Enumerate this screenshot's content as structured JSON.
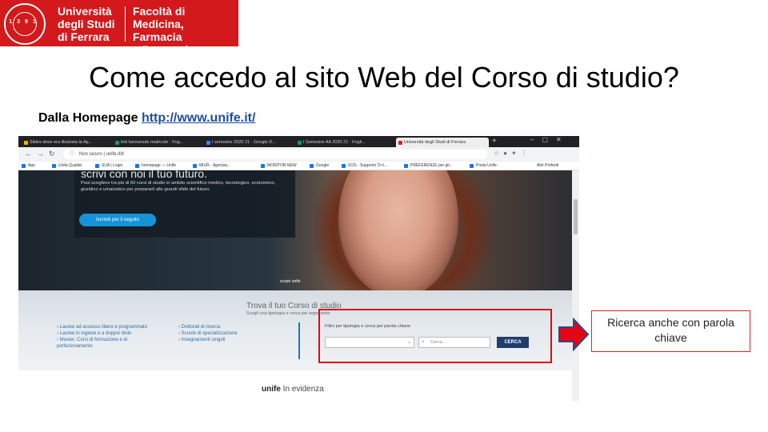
{
  "header": {
    "seal_text": "1391",
    "university": "Università\ndegli Studi\ndi Ferrara",
    "faculty": "Facoltà di Medicina,\nFarmacia\ne Prevenzione"
  },
  "slide": {
    "title": "Come accedo al sito Web del Corso di studio?",
    "subtitle_prefix": "Dalla Homepage ",
    "subtitle_link": "http://www.unife.it/",
    "callout": "Ricerca anche con parola chiave"
  },
  "browser": {
    "tabs": [
      "Slides dove era illustrata la Ap...",
      "link benvenuto matricole · Fog...",
      "I semestre 2020 21 · Google D...",
      "I Semestre AA 2020 21 · Fogli...",
      "Università degli Studi di Ferrara"
    ],
    "url": "unife.it/it",
    "url_label": "Non sicuro",
    "bookmarks": [
      "App",
      "Unità Qualità",
      "SUA | Login",
      "homepage — Unife",
      "MIUR - Agenzia...",
      "MONITOR NEW",
      "Google",
      "SOS - Supporto O+I...",
      "PREFERENZE per gli...",
      "Posta Unife"
    ],
    "other_bookmarks": "Altri Preferiti",
    "hero": {
      "heading": "scrivi con noi il tuo futuro.",
      "text": "Puoi scegliere tra più di 60 corsi di studio in ambito scientifico medico, tecnologico, economico, giuridico e umanistico per prepararti alle grandi sfide del futuro.",
      "button": "Iscriviti per il seguito",
      "scroll_hint": "scopri unife"
    },
    "finder": {
      "title": "Trova il tuo Corso di studio",
      "hint": "Scegli una tipologia o cerca per argomento",
      "links_left": "› Lauree ad accesso libero e programmato\n› Lauree in inglese e a doppio titolo\n› Master, Corsi di formazione e di\n  perfezionamento",
      "links_right": "› Dottorati di ricerca\n› Scuole di specializzazione\n› Insegnamenti singoli",
      "filter_label": "Filtro per tipologia e cerca per parola chiave",
      "select_value": "",
      "search_placeholder": "Cerca...",
      "search_button": "CERCA"
    },
    "evidence": "In evidenza",
    "evidence_brand": "unife"
  },
  "colors": {
    "brand_red": "#d3191c",
    "highlight_red": "#e30613",
    "button_blue": "#1f3e6b",
    "link_blue": "#1f4e9b"
  }
}
